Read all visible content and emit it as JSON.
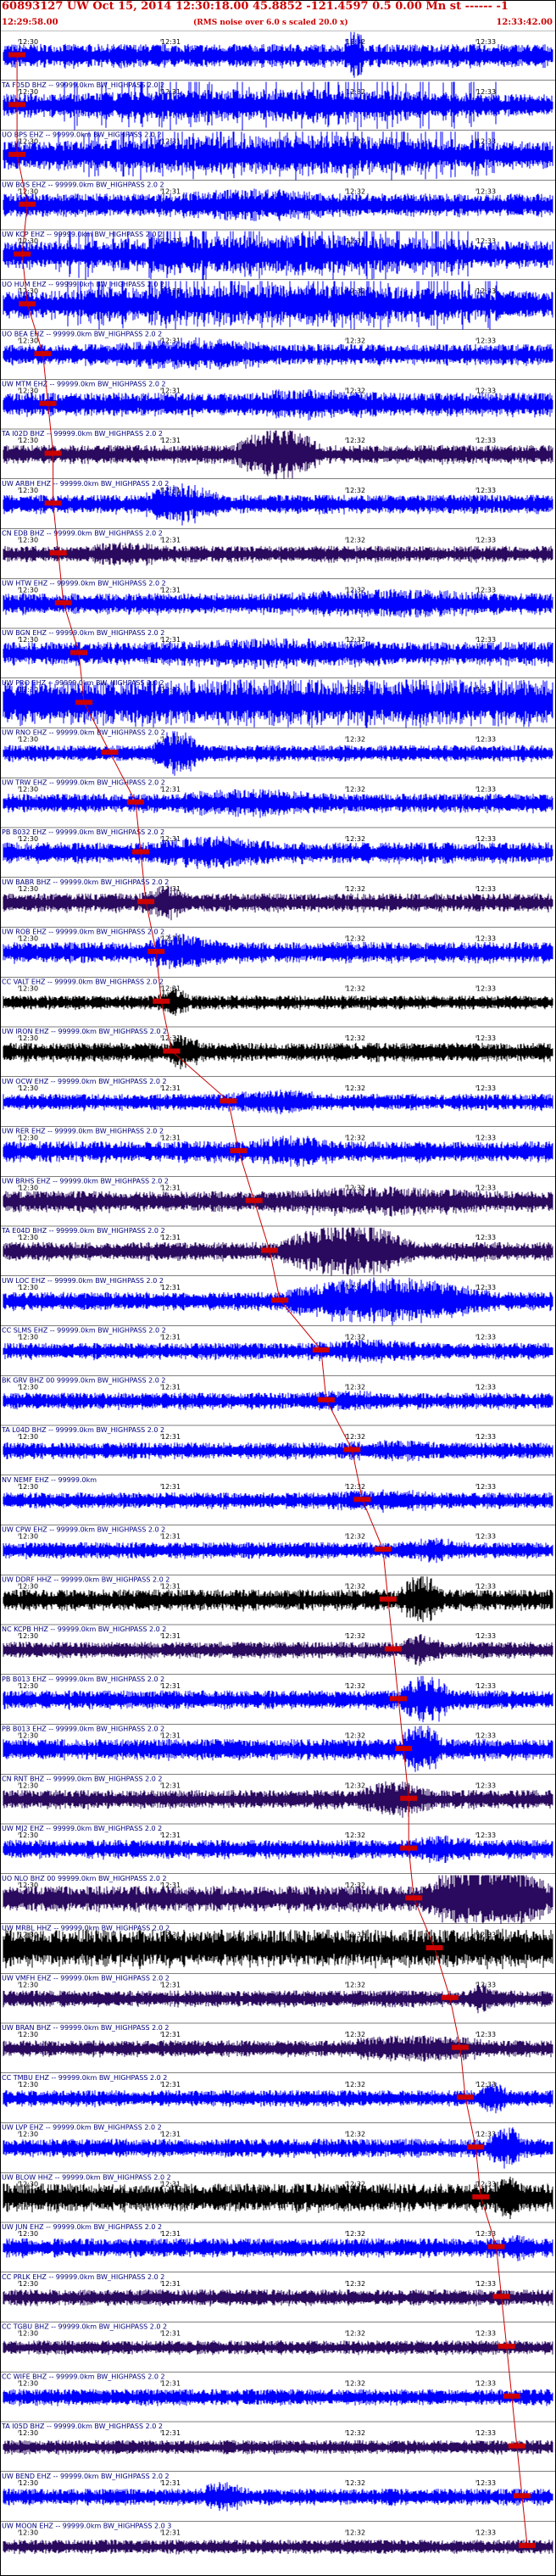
{
  "header": {
    "title": "60893127 UW Oct 15, 2014 12:30:18.00   45.8852 -121.4597  0.5 0.00 Mn st ------ -1",
    "start_time": "12:29:58.00",
    "note": "(RMS noise over 6.0 s scaled 20.0 x)",
    "end_time": "12:33:42.00"
  },
  "time_ticks": [
    "12:30",
    "12:31",
    "12:32",
    "12:33"
  ],
  "colors": {
    "blue": "#0000ff",
    "purple": "#2a0a5e",
    "black": "#000000",
    "pick": "#cc0000",
    "label": "#000080"
  },
  "stations": [
    {
      "label": "",
      "color": "blue",
      "amp": 0.5,
      "burst": [
        0.62,
        0.66,
        2.2
      ],
      "pick": 0.01,
      "sat": 0
    },
    {
      "label": "TA F05D BHZ -- 99999.0km BW_HIGHPASS  2.0  2",
      "color": "blue",
      "amp": 0.5,
      "burst": [
        0.1,
        0.9,
        1.4
      ],
      "pick": 0.01,
      "sat": 0.25,
      "dense": true
    },
    {
      "label": "UO BPS EHZ -- 99999.0km BW_HIGHPASS  2.0  2",
      "color": "blue",
      "amp": 0.6,
      "burst": [
        0.1,
        0.9,
        1.4
      ],
      "pick": 0.01,
      "sat": 0.25,
      "dense": true
    },
    {
      "label": "UW BOS EHZ -- 99999.0km BW_HIGHPASS  2.0  2",
      "color": "blue",
      "amp": 0.5,
      "burst": [
        0.3,
        0.6,
        1.4
      ],
      "pick": 0.03,
      "sat": 0
    },
    {
      "label": "UW KCP EHZ -- 99999.0km BW_HIGHPASS  2.0  2",
      "color": "blue",
      "amp": 0.6,
      "burst": [
        0.1,
        0.9,
        1.4
      ],
      "pick": 0.02,
      "sat": 0.25,
      "dense": true
    },
    {
      "label": "UO HUM EHZ -- 99999.0km BW_HIGHPASS  2.0  2",
      "color": "blue",
      "amp": 0.6,
      "burst": [
        0.1,
        0.9,
        1.4
      ],
      "pick": 0.03,
      "sat": 0.25,
      "dense": true
    },
    {
      "label": "UO BEA EHZ -- 99999.0km BW_HIGHPASS  2.0  2",
      "color": "blue",
      "amp": 0.45,
      "burst": [
        0.2,
        0.5,
        1.6
      ],
      "pick": 0.06,
      "sat": 0
    },
    {
      "label": "UW MTM EHZ -- 99999.0km BW_HIGHPASS  2.0  2",
      "color": "blue",
      "amp": 0.5,
      "burst": [
        0.4,
        0.7,
        1.3
      ],
      "pick": 0.07,
      "sat": 0
    },
    {
      "label": "TA I02D BHZ -- 99999.0km BW_HIGHPASS  2.0  2",
      "color": "purple",
      "amp": 0.4,
      "burst": [
        0.42,
        0.58,
        3.0
      ],
      "pick": 0.08,
      "sat": 0
    },
    {
      "label": "UW ARBH EHZ -- 99999.0km BW_HIGHPASS  2.0  2",
      "color": "blue",
      "amp": 0.4,
      "burst": [
        0.25,
        0.4,
        2.2
      ],
      "pick": 0.08,
      "sat": 0
    },
    {
      "label": "CN EDB BHZ -- 99999.0km BW_HIGHPASS  2.0  2",
      "color": "purple",
      "amp": 0.35,
      "burst": [
        0.15,
        0.3,
        1.5
      ],
      "pick": 0.09,
      "sat": 0
    },
    {
      "label": "UW HTW EHZ -- 99999.0km BW_HIGHPASS  2.0  2",
      "color": "blue",
      "amp": 0.45,
      "burst": [
        0.5,
        0.9,
        1.4
      ],
      "pick": 0.1,
      "sat": 0
    },
    {
      "label": "UW BGN EHZ -- 99999.0km BW_HIGHPASS  2.0  2",
      "color": "blue",
      "amp": 0.5,
      "burst": [
        0.3,
        0.7,
        1.3
      ],
      "pick": 0.13,
      "sat": 0
    },
    {
      "label": "UW PRO EHZ -- 99999.0km BW_HIGHPASS  2.0  2",
      "color": "blue",
      "amp": 0.95,
      "burst": [
        0.15,
        1.0,
        1.1
      ],
      "pick": 0.14,
      "sat": 0
    },
    {
      "label": "UW RNO EHZ -- 99999.0km BW_HIGHPASS  2.0  2",
      "color": "blue",
      "amp": 0.35,
      "burst": [
        0.27,
        0.36,
        2.8
      ],
      "pick": 0.19,
      "sat": 0
    },
    {
      "label": "UW TRW EHZ -- 99999.0km BW_HIGHPASS  2.0  2",
      "color": "blue",
      "amp": 0.4,
      "burst": [
        0.3,
        0.6,
        1.5
      ],
      "pick": 0.24,
      "sat": 0
    },
    {
      "label": "PB B032 EHZ -- 99999.0km BW_HIGHPASS  2.0  2",
      "color": "blue",
      "amp": 0.45,
      "burst": [
        0.25,
        0.5,
        1.6
      ],
      "pick": 0.25,
      "sat": 0
    },
    {
      "label": "UW BABR BHZ -- 99999.0km BW_HIGHPASS  2.0  2",
      "color": "purple",
      "amp": 0.4,
      "burst": [
        0.25,
        0.35,
        1.8
      ],
      "pick": 0.26,
      "sat": 0
    },
    {
      "label": "UW ROB EHZ -- 99999.0km BW_HIGHPASS  2.0  2",
      "color": "blue",
      "amp": 0.45,
      "burst": [
        0.25,
        0.4,
        1.8
      ],
      "pick": 0.28,
      "sat": 0
    },
    {
      "label": "CC VALT EHZ -- 99999.0km BW_HIGHPASS  2.0  2",
      "color": "black",
      "amp": 0.3,
      "burst": [
        0.28,
        0.34,
        2.2
      ],
      "pick": 0.29,
      "sat": 0
    },
    {
      "label": "UW IRON EHZ -- 99999.0km BW_HIGHPASS  2.0  2",
      "color": "black",
      "amp": 0.4,
      "burst": [
        0.3,
        0.36,
        2.0
      ],
      "pick": 0.31,
      "sat": 0
    },
    {
      "label": "UW OCW EHZ -- 99999.0km BW_HIGHPASS  2.0  2",
      "color": "blue",
      "amp": 0.35,
      "burst": [
        0.4,
        0.6,
        1.5
      ],
      "pick": 0.42,
      "sat": 0
    },
    {
      "label": "UW RER EHZ -- 99999.0km BW_HIGHPASS  2.0  2",
      "color": "blue",
      "amp": 0.45,
      "burst": [
        0.45,
        0.6,
        1.6
      ],
      "pick": 0.44,
      "sat": 0
    },
    {
      "label": "UW BRHS EHZ -- 99999.0km BW_HIGHPASS  2.0  2",
      "color": "purple",
      "amp": 0.45,
      "burst": [
        0.5,
        0.88,
        1.4
      ],
      "pick": 0.47,
      "sat": 0
    },
    {
      "label": "TA E04D BHZ -- 99999.0km BW_HIGHPASS  2.0  2",
      "color": "purple",
      "amp": 0.4,
      "burst": [
        0.5,
        0.75,
        3.0
      ],
      "pick": 0.5,
      "sat": 0
    },
    {
      "label": "UW LOC EHZ -- 99999.0km BW_HIGHPASS  2.0  2",
      "color": "blue",
      "amp": 0.4,
      "burst": [
        0.5,
        0.9,
        2.5
      ],
      "pick": 0.52,
      "sat": 0
    },
    {
      "label": "CC SLMS EHZ -- 99999.0km BW_HIGHPASS  2.0  2",
      "color": "blue",
      "amp": 0.35,
      "burst": [
        0.55,
        0.8,
        1.4
      ],
      "pick": 0.6,
      "sat": 0
    },
    {
      "label": "BK GRV BHZ 00 99999.0km BW_HIGHPASS  2.0  2",
      "color": "blue",
      "amp": 0.35,
      "burst": [
        0.55,
        0.7,
        1.3
      ],
      "pick": 0.61,
      "sat": 0
    },
    {
      "label": "TA L04D BHZ -- 99999.0km BW_HIGHPASS  2.0  2",
      "color": "blue",
      "amp": 0.35,
      "burst": [
        0.6,
        0.8,
        1.3
      ],
      "pick": 0.66,
      "sat": 0
    },
    {
      "label": "NV NEMF EHZ -- 99999.0km",
      "color": "blue",
      "amp": 0.35,
      "burst": [
        0.6,
        0.8,
        1.4
      ],
      "pick": 0.68,
      "sat": 0
    },
    {
      "label": "UW CPW EHZ -- 99999.0km BW_HIGHPASS  2.0  2",
      "color": "blue",
      "amp": 0.35,
      "burst": [
        0.72,
        0.85,
        1.5
      ],
      "pick": 0.72,
      "sat": 0
    },
    {
      "label": "UW DDRF HHZ -- 99999.0km BW_HIGHPASS  2.0  2",
      "color": "black",
      "amp": 0.45,
      "burst": [
        0.72,
        0.8,
        2.4
      ],
      "pick": 0.73,
      "sat": 0
    },
    {
      "label": "NC KCPB HHZ -- 99999.0km BW_HIGHPASS  2.0  2",
      "color": "purple",
      "amp": 0.35,
      "burst": [
        0.72,
        0.8,
        2.0
      ],
      "pick": 0.74,
      "sat": 0
    },
    {
      "label": "PB B013 EHZ -- 99999.0km BW_HIGHPASS  2.0  2",
      "color": "blue",
      "amp": 0.4,
      "burst": [
        0.72,
        0.82,
        2.6
      ],
      "pick": 0.75,
      "sat": 0
    },
    {
      "label": "PB B013 EHZ -- 99999.0km BW_HIGHPASS  2.0  2",
      "color": "blue",
      "amp": 0.45,
      "burst": [
        0.72,
        0.8,
        2.5
      ],
      "pick": 0.76,
      "sat": 0
    },
    {
      "label": "CN RNT BHZ -- 99999.0km BW_HIGHPASS  2.0  2",
      "color": "purple",
      "amp": 0.4,
      "burst": [
        0.65,
        0.78,
        2.0
      ],
      "pick": 0.77,
      "sat": 0
    },
    {
      "label": "UW MJ2 EHZ -- 99999.0km BW_HIGHPASS  2.0  2",
      "color": "blue",
      "amp": 0.4,
      "burst": [
        0.74,
        0.86,
        1.5
      ],
      "pick": 0.77,
      "sat": 0
    },
    {
      "label": "UO NLO BHZ 00 99999.0km BW_HIGHPASS  2.0  2",
      "color": "purple",
      "amp": 0.55,
      "burst": [
        0.76,
        1.0,
        3.0
      ],
      "pick": 0.78,
      "sat": 0
    },
    {
      "label": "UW MRBL HHZ -- 99999.0km BW_HIGHPASS  2.0  2",
      "color": "black",
      "amp": 0.8,
      "burst": [
        0.8,
        0.95,
        1.1
      ],
      "pick": 0.82,
      "sat": 0
    },
    {
      "label": "UW VMFH EHZ -- 99999.0km BW_HIGHPASS  2.0  2",
      "color": "purple",
      "amp": 0.35,
      "burst": [
        0.84,
        0.9,
        1.8
      ],
      "pick": 0.85,
      "sat": 0
    },
    {
      "label": "UW BRAN BHZ -- 99999.0km BW_HIGHPASS  2.0  2",
      "color": "purple",
      "amp": 0.35,
      "burst": [
        0.6,
        0.9,
        1.6
      ],
      "pick": 0.87,
      "sat": 0
    },
    {
      "label": "CC TMBU EHZ -- 99999.0km BW_HIGHPASS  2.0  2",
      "color": "blue",
      "amp": 0.35,
      "burst": [
        0.86,
        0.92,
        2.0
      ],
      "pick": 0.88,
      "sat": 0
    },
    {
      "label": "UW LVP EHZ -- 99999.0km BW_HIGHPASS  2.0  2",
      "color": "blue",
      "amp": 0.4,
      "burst": [
        0.88,
        0.95,
        2.5
      ],
      "pick": 0.9,
      "sat": 0
    },
    {
      "label": "UW BLOW HHZ -- 99999.0km BW_HIGHPASS  2.0  2",
      "color": "black",
      "amp": 0.6,
      "burst": [
        0.89,
        0.95,
        1.6
      ],
      "pick": 0.91,
      "sat": 0
    },
    {
      "label": "UW JUN EHZ -- 99999.0km BW_HIGHPASS  2.0  2",
      "color": "blue",
      "amp": 0.4,
      "burst": [
        0.9,
        0.98,
        1.4
      ],
      "pick": 0.94,
      "sat": 0
    },
    {
      "label": "CC PRLK EHZ -- 99999.0km BW_HIGHPASS  2.0  2",
      "color": "purple",
      "amp": 0.35,
      "burst": [
        0.1,
        0.2,
        1.0
      ],
      "pick": 0.95,
      "sat": 0
    },
    {
      "label": "CC TGBU BHZ -- 99999.0km BW_HIGHPASS  2.0  2",
      "color": "purple",
      "amp": 0.3,
      "burst": [
        0.1,
        0.2,
        1.0
      ],
      "pick": 0.96,
      "sat": 0
    },
    {
      "label": "CC WIFE BHZ -- 99999.0km BW_HIGHPASS  2.0  2",
      "color": "blue",
      "amp": 0.35,
      "burst": [
        0.1,
        0.2,
        1.0
      ],
      "pick": 0.97,
      "sat": 0
    },
    {
      "label": "TA I05D BHZ -- 99999.0km BW_HIGHPASS  2.0  2",
      "color": "purple",
      "amp": 0.3,
      "burst": [
        0.1,
        0.2,
        1.0
      ],
      "pick": 0.98,
      "sat": 0
    },
    {
      "label": "UW BEND EHZ -- 99999.0km BW_HIGHPASS  2.0  2",
      "color": "blue",
      "amp": 0.35,
      "burst": [
        0.35,
        0.45,
        1.8
      ],
      "pick": 0.99,
      "sat": 0
    },
    {
      "label": "UW MOON EHZ -- 99999.0km BW_HIGHPASS  2.0  3",
      "color": "purple",
      "amp": 0.3,
      "burst": [
        0.1,
        0.2,
        1.0
      ],
      "pick": 1.0,
      "sat": 0
    }
  ]
}
